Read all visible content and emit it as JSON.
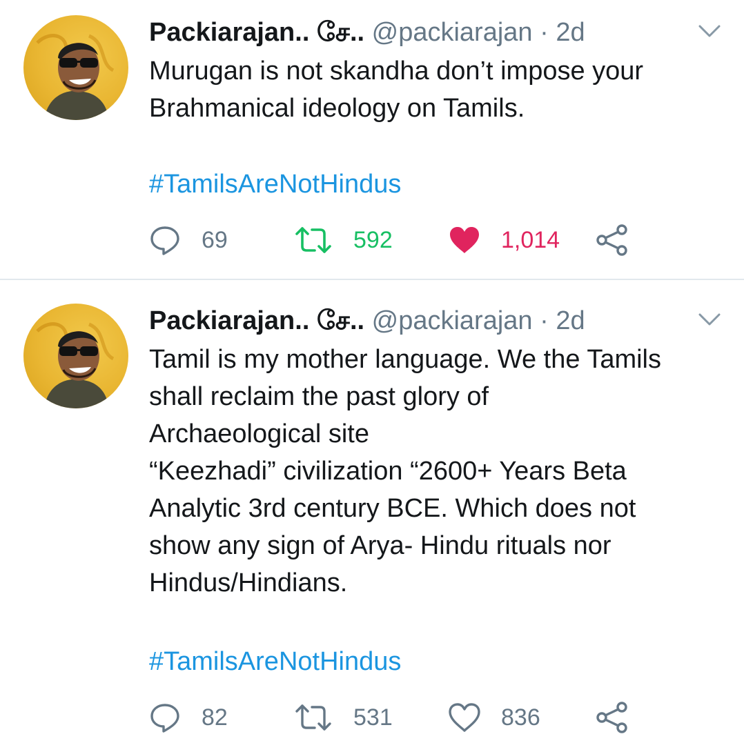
{
  "tweets": [
    {
      "display_name": "Packiarajan.. சே..",
      "handle": "@packiarajan",
      "separator": "·",
      "time": "2d",
      "text": "Murugan is not skandha don’t impose your\nBrahmanical ideology on Tamils.",
      "hashtag": "#TamilsAreNotHindus",
      "replies": "69",
      "retweets": "592",
      "likes": "1,014",
      "liked": true,
      "retweeted": true
    },
    {
      "display_name": "Packiarajan.. சே..",
      "handle": "@packiarajan",
      "separator": "·",
      "time": "2d",
      "text": "Tamil is my mother language. We the Tamils\nshall reclaim the past glory of\nArchaeological site\n“Keezhadi” civilization “2600+ Years Beta\nAnalytic 3rd century BCE. Which does not\nshow any sign of Arya- Hindu rituals nor\nHindus/Hindians.",
      "hashtag": "#TamilsAreNotHindus",
      "replies": "82",
      "retweets": "531",
      "likes": "836",
      "liked": false,
      "retweeted": false
    }
  ],
  "colors": {
    "text": "#14171a",
    "muted": "#657786",
    "link": "#1b95e0",
    "retweet_active": "#17bf63",
    "like_active": "#e0245e",
    "divider": "#e1e8ed"
  },
  "icons": [
    "avatar",
    "chevron-down-icon",
    "reply-icon",
    "retweet-icon",
    "heart-icon",
    "share-icon"
  ]
}
